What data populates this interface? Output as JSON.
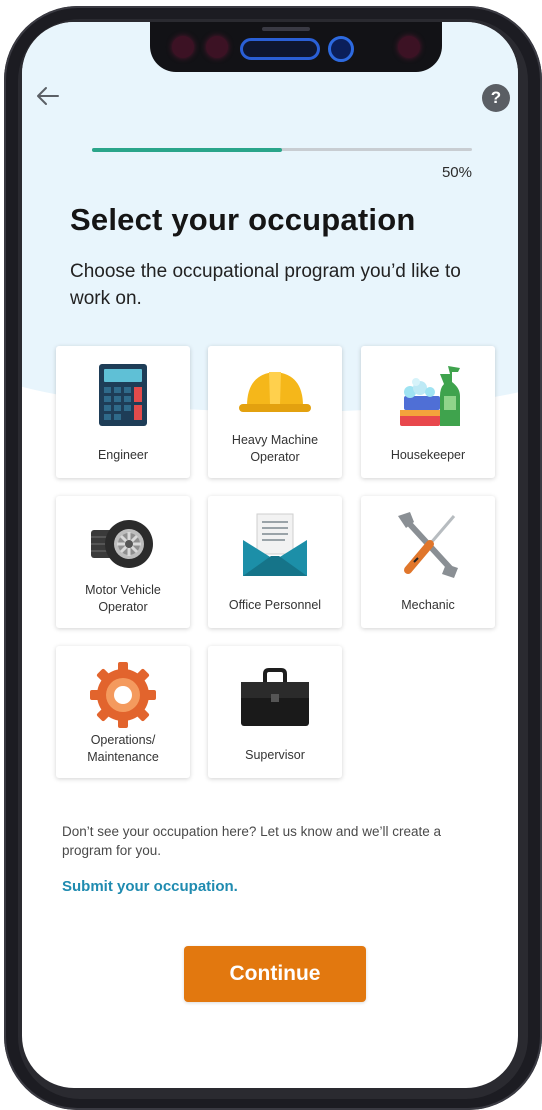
{
  "header": {
    "back_icon": "arrow-left-icon",
    "help_icon": "question-mark-icon",
    "help_glyph": "?"
  },
  "progress": {
    "value_percent": 50,
    "label": "50%",
    "fill_color": "#2aa58a",
    "track_color": "#c8cdd2"
  },
  "page": {
    "title": "Select your occupation",
    "subtitle": "Choose the occupational program you’d like to work on."
  },
  "occupations": [
    {
      "label": "Engineer",
      "icon": "calculator-icon"
    },
    {
      "label": "Heavy Machine Operator",
      "icon": "hard-hat-icon"
    },
    {
      "label": "Housekeeper",
      "icon": "cleaning-supplies-icon"
    },
    {
      "label": "Motor Vehicle Operator",
      "icon": "tire-icon"
    },
    {
      "label": "Office Personnel",
      "icon": "envelope-icon"
    },
    {
      "label": "Mechanic",
      "icon": "wrench-screwdriver-icon"
    },
    {
      "label": "Operations/ Maintenance",
      "icon": "gear-icon"
    },
    {
      "label": "Supervisor",
      "icon": "briefcase-icon"
    }
  ],
  "footer": {
    "prompt": "Don’t see your occupation here? Let us know and we’ll create a program for you.",
    "submit_link": "Submit your occupation.",
    "continue_label": "Continue"
  },
  "colors": {
    "accent": "#e2780f",
    "link": "#1f8bb0",
    "hero_background": "#e8f5fc"
  }
}
